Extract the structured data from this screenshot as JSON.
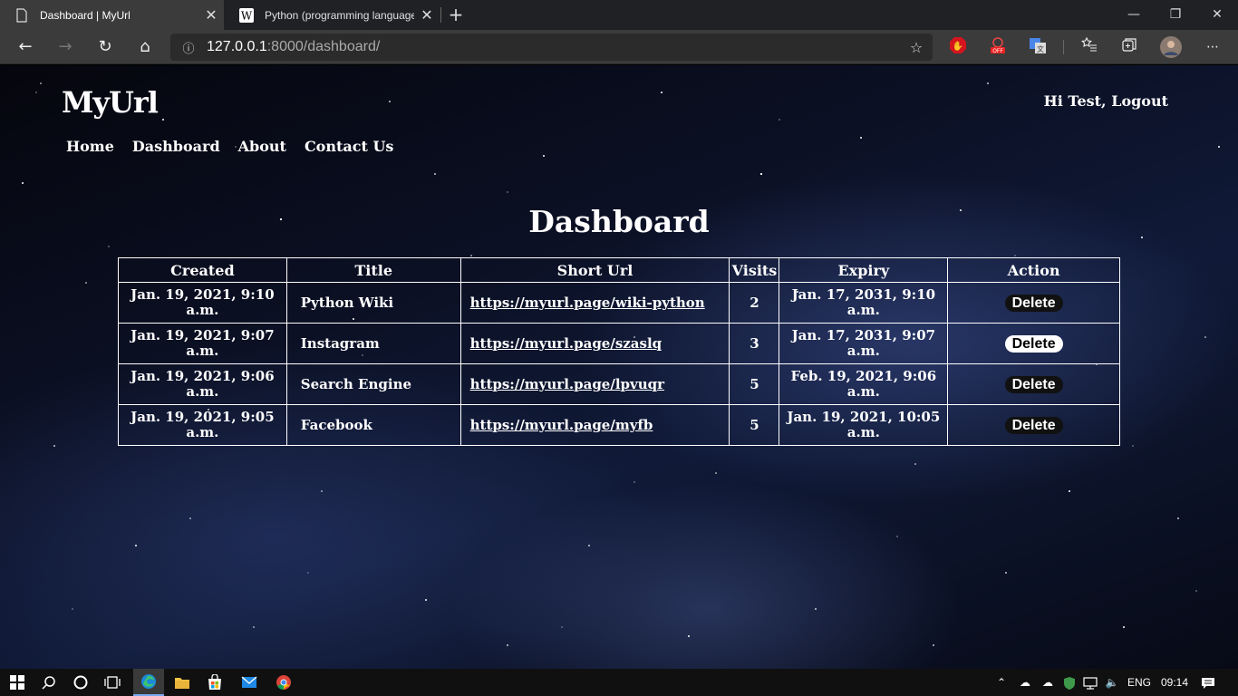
{
  "browser": {
    "tabs": [
      {
        "title": "Dashboard | MyUrl",
        "close": "✕"
      },
      {
        "title": "Python (programming language)",
        "close": "✕"
      }
    ],
    "new_tab": "+",
    "window_controls": {
      "minimize": "—",
      "restore": "❐",
      "close": "✕"
    },
    "nav": {
      "back": "←",
      "forward": "→",
      "reload": "↻",
      "home": "⌂"
    },
    "url_host": "127.0.0.1",
    "url_path": ":8000/dashboard/",
    "info_icon": "ⓘ",
    "star_icon": "☆",
    "extensions": [
      "adblock-icon",
      "off-extension-icon",
      "translate-icon",
      "favorites-icon",
      "collections-icon",
      "profile-avatar",
      "more-icon"
    ]
  },
  "site": {
    "brand": "MyUrl",
    "greeting": "Hi Test, Logout",
    "menu": [
      "Home",
      "Dashboard",
      "About",
      "Contact Us"
    ],
    "page_title": "Dashboard"
  },
  "table": {
    "headers": [
      "Created",
      "Title",
      "Short Url",
      "Visits",
      "Expiry",
      "Action"
    ],
    "rows": [
      {
        "created": "Jan. 19, 2021, 9:10 a.m.",
        "title": "Python Wiki",
        "short_url": "https://myurl.page/wiki-python",
        "visits": "2",
        "expiry": "Jan. 17, 2031, 9:10 a.m.",
        "action": "Delete"
      },
      {
        "created": "Jan. 19, 2021, 9:07 a.m.",
        "title": "Instagram",
        "short_url": "https://myurl.page/szaslq",
        "visits": "3",
        "expiry": "Jan. 17, 2031, 9:07 a.m.",
        "action": "Delete"
      },
      {
        "created": "Jan. 19, 2021, 9:06 a.m.",
        "title": "Search Engine",
        "short_url": "https://myurl.page/lpvuqr",
        "visits": "5",
        "expiry": "Feb. 19, 2021, 9:06 a.m.",
        "action": "Delete"
      },
      {
        "created": "Jan. 19, 2021, 9:05 a.m.",
        "title": "Facebook",
        "short_url": "https://myurl.page/myfb",
        "visits": "5",
        "expiry": "Jan. 19, 2021, 10:05 a.m.",
        "action": "Delete"
      }
    ]
  },
  "taskbar": {
    "language": "ENG",
    "time": "09:14"
  }
}
